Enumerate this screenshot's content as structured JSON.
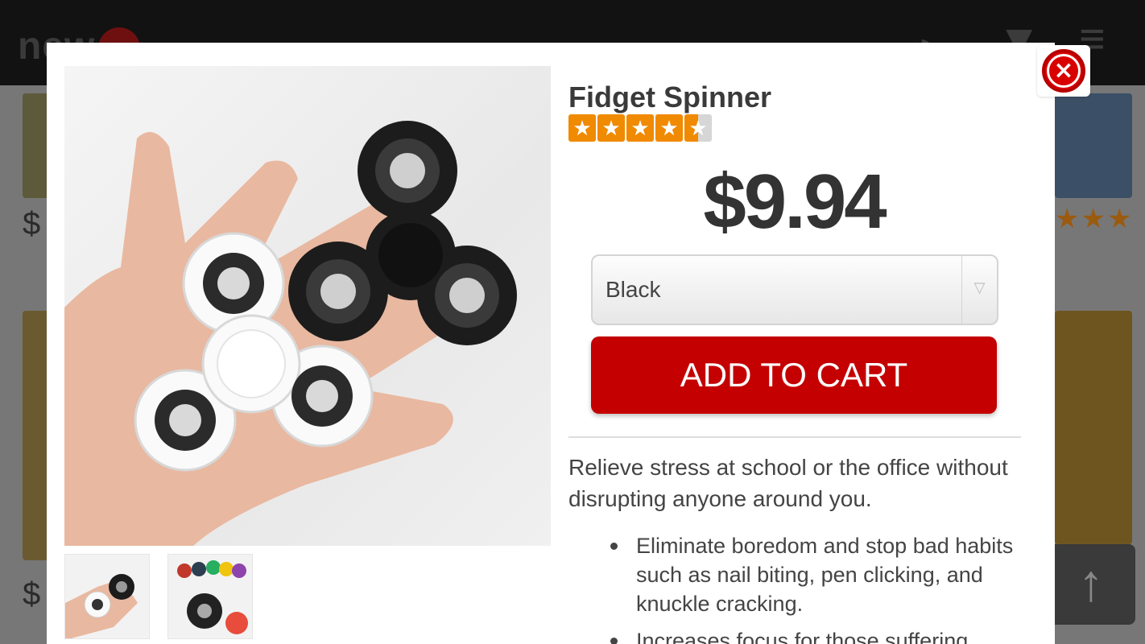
{
  "background": {
    "logo_text": "new",
    "bg_price_1": "$",
    "bg_price_2": "$",
    "scroll_top_icon": "arrow-up-icon",
    "header_icons": [
      "alarm-clock-icon",
      "cart-icon",
      "menu-icon"
    ]
  },
  "modal": {
    "close_icon": "close-icon",
    "product": {
      "title": "Fidget Spinner",
      "rating": 4.5,
      "rating_max": 5,
      "price": "$9.94",
      "color_option": "Black",
      "add_to_cart_label": "ADD TO CART",
      "description": "Relieve stress at school or the office without disrupting anyone around you.",
      "bullets": [
        "Eliminate boredom and stop bad habits such as nail biting, pen clicking, and knuckle cracking.",
        "Increases focus for those suffering"
      ]
    }
  },
  "colors": {
    "accent_red": "#c40000",
    "star_orange": "#f08a00"
  }
}
